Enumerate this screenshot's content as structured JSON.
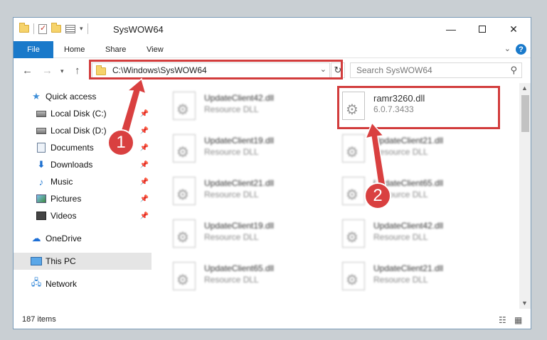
{
  "window": {
    "title": "SysWOW64",
    "minimize_icon": "minimize-icon",
    "maximize_icon": "maximize-icon",
    "close_icon": "close-icon"
  },
  "ribbon": {
    "tabs": [
      "File",
      "Home",
      "Share",
      "View"
    ],
    "help": "?"
  },
  "navigation": {
    "address": "C:\\Windows\\SysWOW64",
    "search_placeholder": "Search SysWOW64"
  },
  "sidebar": {
    "items": [
      {
        "label": "Quick access",
        "icon": "star-icon"
      },
      {
        "label": "Local Disk (C:)",
        "icon": "disk-icon"
      },
      {
        "label": "Local Disk (D:)",
        "icon": "disk-icon"
      },
      {
        "label": "Documents",
        "icon": "documents-icon"
      },
      {
        "label": "Downloads",
        "icon": "download-icon"
      },
      {
        "label": "Music",
        "icon": "music-icon"
      },
      {
        "label": "Pictures",
        "icon": "pictures-icon"
      },
      {
        "label": "Videos",
        "icon": "videos-icon"
      },
      {
        "label": "OneDrive",
        "icon": "cloud-icon"
      },
      {
        "label": "This PC",
        "icon": "computer-icon"
      },
      {
        "label": "Network",
        "icon": "network-icon"
      }
    ]
  },
  "files": [
    {
      "name": "UpdateClient42.dll",
      "sub": "Resource DLL"
    },
    {
      "name": "ramr3260.dll",
      "sub": "6.0.7.3433"
    },
    {
      "name": "UpdateClient19.dll",
      "sub": "Resource DLL"
    },
    {
      "name": "UpdateClient21.dll",
      "sub": "Resource DLL"
    },
    {
      "name": "UpdateClient21.dll",
      "sub": "Resource DLL"
    },
    {
      "name": "UpdateClient65.dll",
      "sub": "Resource DLL"
    },
    {
      "name": "UpdateClient19.dll",
      "sub": "Resource DLL"
    },
    {
      "name": "UpdateClient42.dll",
      "sub": "Resource DLL"
    },
    {
      "name": "UpdateClient65.dll",
      "sub": "Resource DLL"
    },
    {
      "name": "UpdateClient21.dll",
      "sub": "Resource DLL"
    }
  ],
  "status": {
    "item_count": "187 items"
  },
  "annotations": {
    "step1": "1",
    "step2": "2",
    "color": "#d23c3c"
  }
}
